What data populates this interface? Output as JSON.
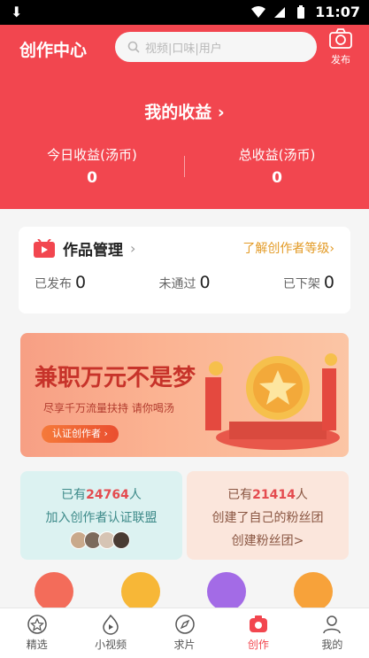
{
  "status_bar": {
    "time": "11:07"
  },
  "header": {
    "title": "创作中心",
    "search_placeholder": "视频|口味|用户",
    "publish_label": "发布"
  },
  "earnings": {
    "title": "我的收益",
    "today_label": "今日收益(汤币)",
    "today_value": "0",
    "total_label": "总收益(汤币)",
    "total_value": "0"
  },
  "works": {
    "title": "作品管理",
    "level_link": "了解创作者等级",
    "published_label": "已发布",
    "published_value": "0",
    "rejected_label": "未通过",
    "rejected_value": "0",
    "removed_label": "已下架",
    "removed_value": "0"
  },
  "banner": {
    "headline": "兼职万元不是梦",
    "subline": "尽享千万流量扶持 请你喝汤",
    "button": "认证创作者"
  },
  "promo_left": {
    "prefix": "已有",
    "count": "24764",
    "suffix": "人",
    "line2": "加入创作者认证联盟"
  },
  "promo_right": {
    "prefix": "已有",
    "count": "21414",
    "suffix": "人",
    "line2": "创建了自己的粉丝团",
    "link": "创建粉丝团>"
  },
  "tabs": [
    {
      "label": "精选"
    },
    {
      "label": "小视频"
    },
    {
      "label": "求片"
    },
    {
      "label": "创作"
    },
    {
      "label": "我的"
    }
  ],
  "colors": {
    "brand": "#f2464f",
    "gold": "#e39b27"
  }
}
